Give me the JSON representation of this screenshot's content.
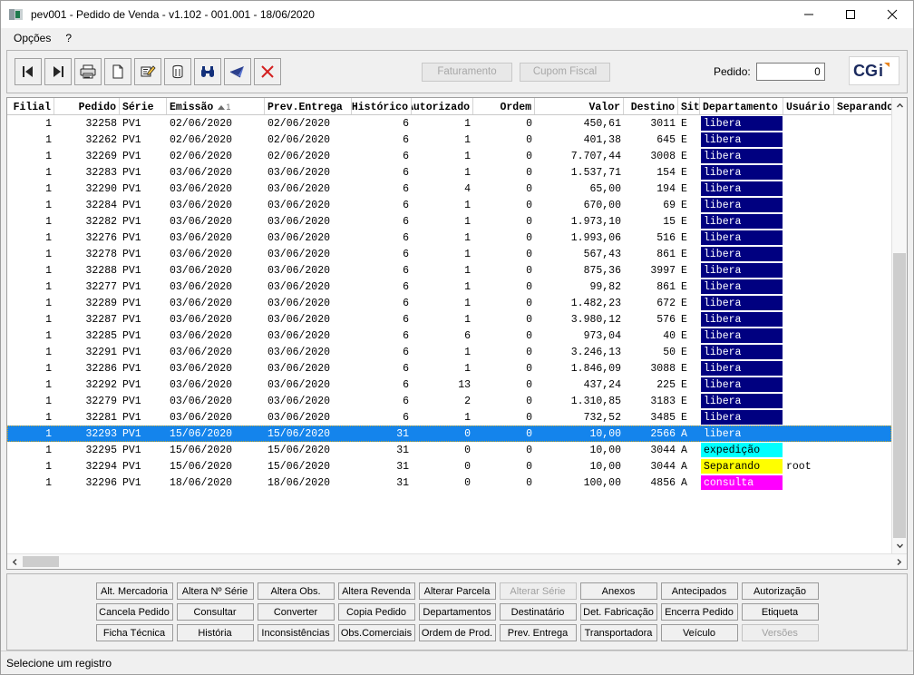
{
  "window": {
    "title": "pev001 - Pedido de Venda - v1.102 - 001.001 - 18/06/2020",
    "minimize_label": "minimize-icon",
    "maximize_label": "maximize-icon",
    "close_label": "close-icon"
  },
  "menu": {
    "items": [
      "Opções",
      "?"
    ]
  },
  "toolbar": {
    "buttons": [
      {
        "name": "first-record-icon",
        "title": "Primeiro"
      },
      {
        "name": "last-record-icon",
        "title": "Último"
      },
      {
        "name": "print-icon",
        "title": "Imprimir"
      },
      {
        "name": "new-document-icon",
        "title": "Novo"
      },
      {
        "name": "edit-pencil-icon",
        "title": "Editar"
      },
      {
        "name": "delete-trash-icon",
        "title": "Excluir"
      },
      {
        "name": "search-binoculars-icon",
        "title": "Pesquisar"
      },
      {
        "name": "filter-flag-icon",
        "title": "Filtro"
      },
      {
        "name": "cancel-x-icon",
        "title": "Cancelar"
      }
    ],
    "faturamento_label": "Faturamento",
    "cupom_fiscal_label": "Cupom Fiscal",
    "pedido_label": "Pedido:",
    "pedido_value": "0",
    "pedido_placeholder": "",
    "logo_text": "CGi"
  },
  "grid": {
    "columns": [
      {
        "label": "Filial",
        "width": 52,
        "align": "right"
      },
      {
        "label": "Pedido",
        "width": 72,
        "align": "right"
      },
      {
        "label": "Série",
        "width": 52,
        "align": "left"
      },
      {
        "label": "Emissão",
        "width": 108,
        "align": "left",
        "sort": "asc",
        "sort_order": "1"
      },
      {
        "label": "Prev.Entrega",
        "width": 96,
        "align": "left"
      },
      {
        "label": "Histórico",
        "width": 66,
        "align": "right"
      },
      {
        "label": "Autorizado",
        "width": 68,
        "align": "right"
      },
      {
        "label": "Ordem",
        "width": 68,
        "align": "right"
      },
      {
        "label": "Valor",
        "width": 98,
        "align": "right"
      },
      {
        "label": "Destino",
        "width": 60,
        "align": "right"
      },
      {
        "label": "Sit",
        "width": 24,
        "align": "left"
      },
      {
        "label": "Departamento",
        "width": 92,
        "align": "left"
      },
      {
        "label": "Usuário",
        "width": 56,
        "align": "left"
      },
      {
        "label": "Separando",
        "width": 72,
        "align": "left"
      }
    ],
    "rows": [
      {
        "filial": "1",
        "pedido": "32258",
        "serie": "PV1",
        "emissao": "02/06/2020",
        "prev": "02/06/2020",
        "historico": "6",
        "autorizado": "1",
        "ordem": "0",
        "valor": "450,61",
        "destino": "3011",
        "sit": "E",
        "departamento": "libera",
        "dep_bg": "#000080",
        "dep_fg": "#ffffff",
        "usuario": "",
        "separando": ""
      },
      {
        "filial": "1",
        "pedido": "32262",
        "serie": "PV1",
        "emissao": "02/06/2020",
        "prev": "02/06/2020",
        "historico": "6",
        "autorizado": "1",
        "ordem": "0",
        "valor": "401,38",
        "destino": "645",
        "sit": "E",
        "departamento": "libera",
        "dep_bg": "#000080",
        "dep_fg": "#ffffff",
        "usuario": "",
        "separando": ""
      },
      {
        "filial": "1",
        "pedido": "32269",
        "serie": "PV1",
        "emissao": "02/06/2020",
        "prev": "02/06/2020",
        "historico": "6",
        "autorizado": "1",
        "ordem": "0",
        "valor": "7.707,44",
        "destino": "3008",
        "sit": "E",
        "departamento": "libera",
        "dep_bg": "#000080",
        "dep_fg": "#ffffff",
        "usuario": "",
        "separando": ""
      },
      {
        "filial": "1",
        "pedido": "32283",
        "serie": "PV1",
        "emissao": "03/06/2020",
        "prev": "03/06/2020",
        "historico": "6",
        "autorizado": "1",
        "ordem": "0",
        "valor": "1.537,71",
        "destino": "154",
        "sit": "E",
        "departamento": "libera",
        "dep_bg": "#000080",
        "dep_fg": "#ffffff",
        "usuario": "",
        "separando": ""
      },
      {
        "filial": "1",
        "pedido": "32290",
        "serie": "PV1",
        "emissao": "03/06/2020",
        "prev": "03/06/2020",
        "historico": "6",
        "autorizado": "4",
        "ordem": "0",
        "valor": "65,00",
        "destino": "194",
        "sit": "E",
        "departamento": "libera",
        "dep_bg": "#000080",
        "dep_fg": "#ffffff",
        "usuario": "",
        "separando": ""
      },
      {
        "filial": "1",
        "pedido": "32284",
        "serie": "PV1",
        "emissao": "03/06/2020",
        "prev": "03/06/2020",
        "historico": "6",
        "autorizado": "1",
        "ordem": "0",
        "valor": "670,00",
        "destino": "69",
        "sit": "E",
        "departamento": "libera",
        "dep_bg": "#000080",
        "dep_fg": "#ffffff",
        "usuario": "",
        "separando": ""
      },
      {
        "filial": "1",
        "pedido": "32282",
        "serie": "PV1",
        "emissao": "03/06/2020",
        "prev": "03/06/2020",
        "historico": "6",
        "autorizado": "1",
        "ordem": "0",
        "valor": "1.973,10",
        "destino": "15",
        "sit": "E",
        "departamento": "libera",
        "dep_bg": "#000080",
        "dep_fg": "#ffffff",
        "usuario": "",
        "separando": ""
      },
      {
        "filial": "1",
        "pedido": "32276",
        "serie": "PV1",
        "emissao": "03/06/2020",
        "prev": "03/06/2020",
        "historico": "6",
        "autorizado": "1",
        "ordem": "0",
        "valor": "1.993,06",
        "destino": "516",
        "sit": "E",
        "departamento": "libera",
        "dep_bg": "#000080",
        "dep_fg": "#ffffff",
        "usuario": "",
        "separando": ""
      },
      {
        "filial": "1",
        "pedido": "32278",
        "serie": "PV1",
        "emissao": "03/06/2020",
        "prev": "03/06/2020",
        "historico": "6",
        "autorizado": "1",
        "ordem": "0",
        "valor": "567,43",
        "destino": "861",
        "sit": "E",
        "departamento": "libera",
        "dep_bg": "#000080",
        "dep_fg": "#ffffff",
        "usuario": "",
        "separando": ""
      },
      {
        "filial": "1",
        "pedido": "32288",
        "serie": "PV1",
        "emissao": "03/06/2020",
        "prev": "03/06/2020",
        "historico": "6",
        "autorizado": "1",
        "ordem": "0",
        "valor": "875,36",
        "destino": "3997",
        "sit": "E",
        "departamento": "libera",
        "dep_bg": "#000080",
        "dep_fg": "#ffffff",
        "usuario": "",
        "separando": ""
      },
      {
        "filial": "1",
        "pedido": "32277",
        "serie": "PV1",
        "emissao": "03/06/2020",
        "prev": "03/06/2020",
        "historico": "6",
        "autorizado": "1",
        "ordem": "0",
        "valor": "99,82",
        "destino": "861",
        "sit": "E",
        "departamento": "libera",
        "dep_bg": "#000080",
        "dep_fg": "#ffffff",
        "usuario": "",
        "separando": ""
      },
      {
        "filial": "1",
        "pedido": "32289",
        "serie": "PV1",
        "emissao": "03/06/2020",
        "prev": "03/06/2020",
        "historico": "6",
        "autorizado": "1",
        "ordem": "0",
        "valor": "1.482,23",
        "destino": "672",
        "sit": "E",
        "departamento": "libera",
        "dep_bg": "#000080",
        "dep_fg": "#ffffff",
        "usuario": "",
        "separando": ""
      },
      {
        "filial": "1",
        "pedido": "32287",
        "serie": "PV1",
        "emissao": "03/06/2020",
        "prev": "03/06/2020",
        "historico": "6",
        "autorizado": "1",
        "ordem": "0",
        "valor": "3.980,12",
        "destino": "576",
        "sit": "E",
        "departamento": "libera",
        "dep_bg": "#000080",
        "dep_fg": "#ffffff",
        "usuario": "",
        "separando": ""
      },
      {
        "filial": "1",
        "pedido": "32285",
        "serie": "PV1",
        "emissao": "03/06/2020",
        "prev": "03/06/2020",
        "historico": "6",
        "autorizado": "6",
        "ordem": "0",
        "valor": "973,04",
        "destino": "40",
        "sit": "E",
        "departamento": "libera",
        "dep_bg": "#000080",
        "dep_fg": "#ffffff",
        "usuario": "",
        "separando": ""
      },
      {
        "filial": "1",
        "pedido": "32291",
        "serie": "PV1",
        "emissao": "03/06/2020",
        "prev": "03/06/2020",
        "historico": "6",
        "autorizado": "1",
        "ordem": "0",
        "valor": "3.246,13",
        "destino": "50",
        "sit": "E",
        "departamento": "libera",
        "dep_bg": "#000080",
        "dep_fg": "#ffffff",
        "usuario": "",
        "separando": ""
      },
      {
        "filial": "1",
        "pedido": "32286",
        "serie": "PV1",
        "emissao": "03/06/2020",
        "prev": "03/06/2020",
        "historico": "6",
        "autorizado": "1",
        "ordem": "0",
        "valor": "1.846,09",
        "destino": "3088",
        "sit": "E",
        "departamento": "libera",
        "dep_bg": "#000080",
        "dep_fg": "#ffffff",
        "usuario": "",
        "separando": ""
      },
      {
        "filial": "1",
        "pedido": "32292",
        "serie": "PV1",
        "emissao": "03/06/2020",
        "prev": "03/06/2020",
        "historico": "6",
        "autorizado": "13",
        "ordem": "0",
        "valor": "437,24",
        "destino": "225",
        "sit": "E",
        "departamento": "libera",
        "dep_bg": "#000080",
        "dep_fg": "#ffffff",
        "usuario": "",
        "separando": ""
      },
      {
        "filial": "1",
        "pedido": "32279",
        "serie": "PV1",
        "emissao": "03/06/2020",
        "prev": "03/06/2020",
        "historico": "6",
        "autorizado": "2",
        "ordem": "0",
        "valor": "1.310,85",
        "destino": "3183",
        "sit": "E",
        "departamento": "libera",
        "dep_bg": "#000080",
        "dep_fg": "#ffffff",
        "usuario": "",
        "separando": ""
      },
      {
        "filial": "1",
        "pedido": "32281",
        "serie": "PV1",
        "emissao": "03/06/2020",
        "prev": "03/06/2020",
        "historico": "6",
        "autorizado": "1",
        "ordem": "0",
        "valor": "732,52",
        "destino": "3485",
        "sit": "E",
        "departamento": "libera",
        "dep_bg": "#000080",
        "dep_fg": "#ffffff",
        "usuario": "",
        "separando": ""
      },
      {
        "filial": "1",
        "pedido": "32293",
        "serie": "PV1",
        "emissao": "15/06/2020",
        "prev": "15/06/2020",
        "historico": "31",
        "autorizado": "0",
        "ordem": "0",
        "valor": "10,00",
        "destino": "2566",
        "sit": "A",
        "departamento": "libera",
        "dep_bg": "transparent",
        "dep_fg": "#ffffff",
        "usuario": "",
        "separando": "",
        "selected": true
      },
      {
        "filial": "1",
        "pedido": "32295",
        "serie": "PV1",
        "emissao": "15/06/2020",
        "prev": "15/06/2020",
        "historico": "31",
        "autorizado": "0",
        "ordem": "0",
        "valor": "10,00",
        "destino": "3044",
        "sit": "A",
        "departamento": "expedição",
        "dep_bg": "#00ffff",
        "dep_fg": "#000000",
        "usuario": "",
        "separando": ""
      },
      {
        "filial": "1",
        "pedido": "32294",
        "serie": "PV1",
        "emissao": "15/06/2020",
        "prev": "15/06/2020",
        "historico": "31",
        "autorizado": "0",
        "ordem": "0",
        "valor": "10,00",
        "destino": "3044",
        "sit": "A",
        "departamento": "Separando",
        "dep_bg": "#ffff00",
        "dep_fg": "#000000",
        "usuario": "root",
        "separando": ""
      },
      {
        "filial": "1",
        "pedido": "32296",
        "serie": "PV1",
        "emissao": "18/06/2020",
        "prev": "18/06/2020",
        "historico": "31",
        "autorizado": "0",
        "ordem": "0",
        "valor": "100,00",
        "destino": "4856",
        "sit": "A",
        "departamento": "consulta",
        "dep_bg": "#ff00ff",
        "dep_fg": "#ffffff",
        "usuario": "",
        "separando": ""
      }
    ]
  },
  "button_panel": {
    "rows": [
      [
        {
          "label": "Alt. Mercadoria",
          "disabled": false
        },
        {
          "label": "Altera Nº Série",
          "disabled": false
        },
        {
          "label": "Altera Obs.",
          "disabled": false
        },
        {
          "label": "Altera Revenda",
          "disabled": false
        },
        {
          "label": "Alterar Parcela",
          "disabled": false
        },
        {
          "label": "Alterar Série",
          "disabled": true
        },
        {
          "label": "Anexos",
          "disabled": false
        },
        {
          "label": "Antecipados",
          "disabled": false
        },
        {
          "label": "Autorização",
          "disabled": false
        }
      ],
      [
        {
          "label": "Cancela Pedido",
          "disabled": false
        },
        {
          "label": "Consultar",
          "disabled": false
        },
        {
          "label": "Converter",
          "disabled": false
        },
        {
          "label": "Copia Pedido",
          "disabled": false
        },
        {
          "label": "Departamentos",
          "disabled": false
        },
        {
          "label": "Destinatário",
          "disabled": false
        },
        {
          "label": "Det. Fabricação",
          "disabled": false
        },
        {
          "label": "Encerra Pedido",
          "disabled": false
        },
        {
          "label": "Etiqueta",
          "disabled": false
        }
      ],
      [
        {
          "label": "Ficha Técnica",
          "disabled": false
        },
        {
          "label": "História",
          "disabled": false
        },
        {
          "label": "Inconsistências",
          "disabled": false
        },
        {
          "label": "Obs.Comerciais",
          "disabled": false
        },
        {
          "label": "Ordem de Prod.",
          "disabled": false
        },
        {
          "label": "Prev. Entrega",
          "disabled": false
        },
        {
          "label": "Transportadora",
          "disabled": false
        },
        {
          "label": "Veículo",
          "disabled": false
        },
        {
          "label": "Versões",
          "disabled": true
        }
      ]
    ]
  },
  "statusbar": {
    "message": "Selecione um registro"
  },
  "colors": {
    "selection": "#1484ec",
    "dep_libera": "#000080",
    "dep_expedicao": "#00ffff",
    "dep_separando": "#ffff00",
    "dep_consulta": "#ff00ff"
  }
}
